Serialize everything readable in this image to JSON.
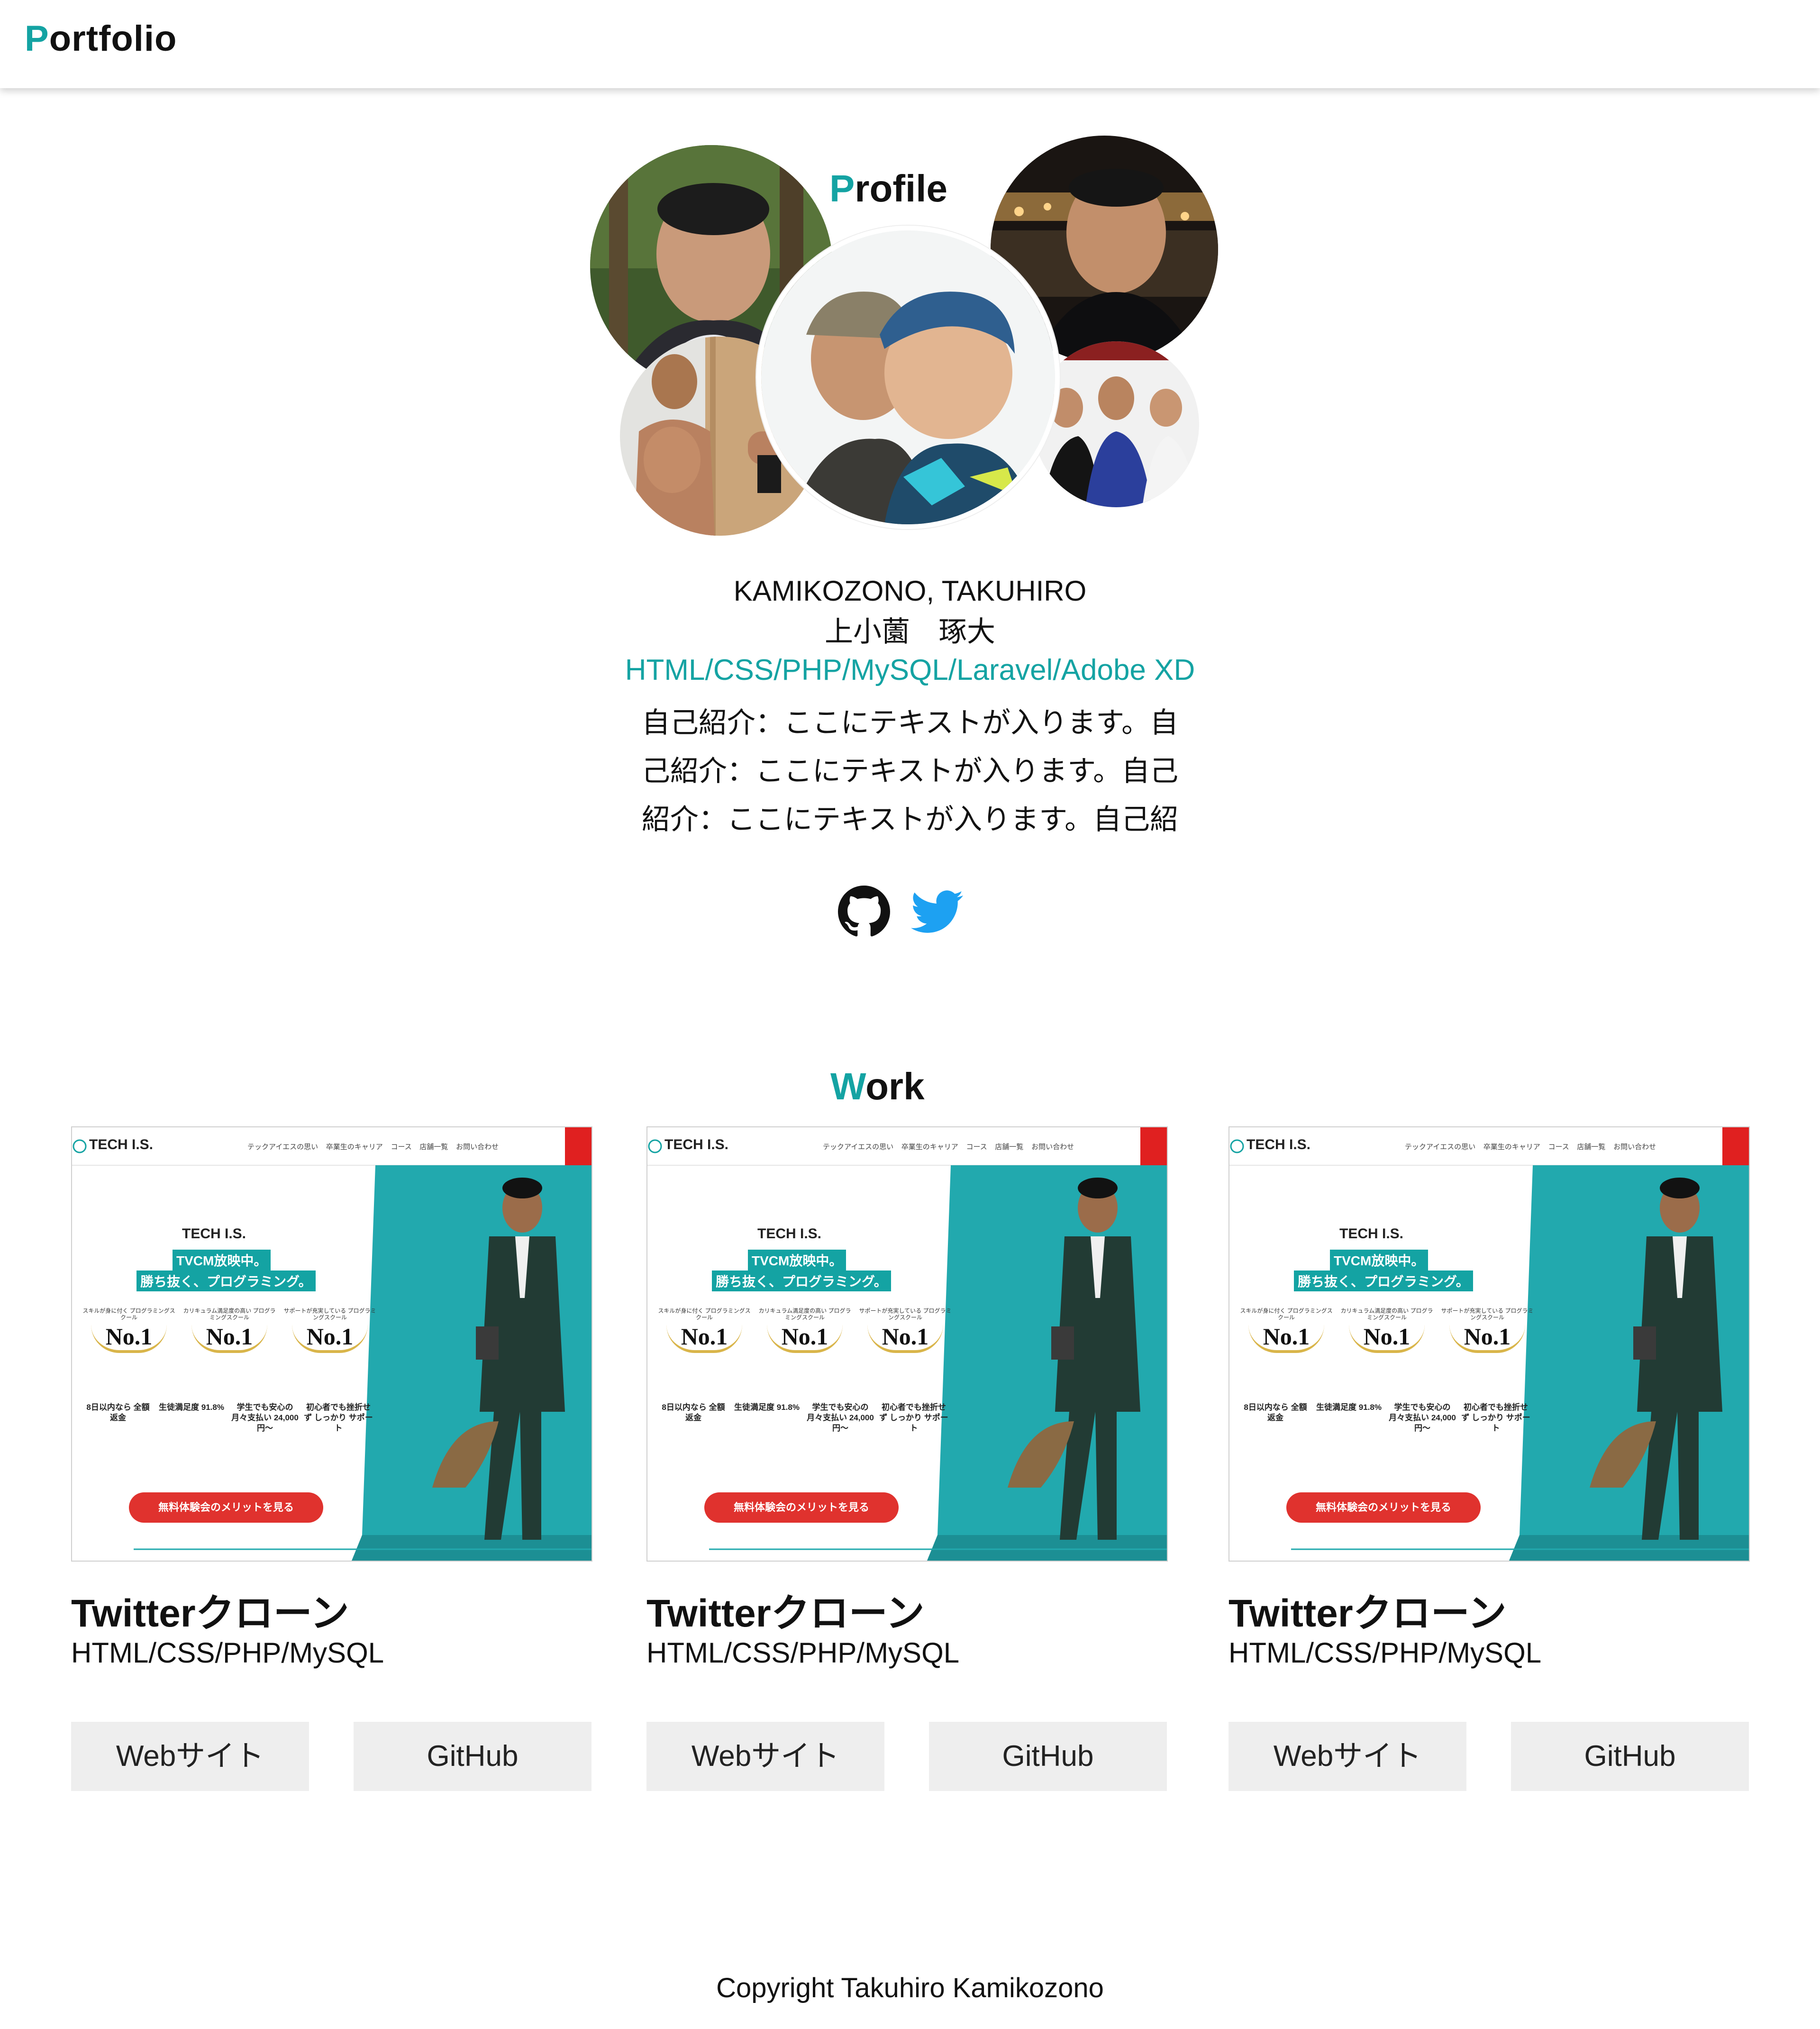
{
  "header": {
    "logo_initial": "P",
    "logo_rest": "ortfolio"
  },
  "profile": {
    "title_initial": "P",
    "title_rest": "rofile",
    "name_en": "KAMIKOZONO, TAKUHIRO",
    "name_ja": "上小薗　琢大",
    "skills": "HTML/CSS/PHP/MySQL/Laravel/Adobe XD",
    "bio_lines": [
      "自己紹介：ここにテキストが入ります。自",
      "己紹介：ここにテキストが入ります。自己",
      "紹介：ここにテキストが入ります。自己紹"
    ],
    "social": [
      "github-icon",
      "twitter-icon"
    ]
  },
  "work": {
    "title_initial": "W",
    "title_rest": "ork",
    "cards": [
      {
        "title": "Twitterクローン",
        "tech": "HTML/CSS/PHP/MySQL",
        "website_label": "Webサイト",
        "github_label": "GitHub",
        "thumb": {
          "brand": "TECH I.S.",
          "nav": [
            "テックアイエスの思い",
            "卒業生のキャリア",
            "コース",
            "店舗一覧",
            "お問い合わせ"
          ],
          "tagline1": "TVCM放映中。",
          "tagline2": "勝ち抜く、プログラミング。",
          "awards": [
            {
              "caption": "スキルが身に付く プログラミングスクール",
              "rank": "No.1"
            },
            {
              "caption": "カリキュラム満足度の高い プログラミングスクール",
              "rank": "No.1"
            },
            {
              "caption": "サポートが充実している プログラミングスクール",
              "rank": "No.1"
            }
          ],
          "stats": [
            "8日以内なら 全額返金",
            "生徒満足度 91.8%",
            "学生でも安心の 月々支払い 24,000円〜",
            "初心者でも挫折せず しっかり サポート"
          ],
          "cta": "無料体験会のメリットを見る"
        }
      },
      {
        "title": "Twitterクローン",
        "tech": "HTML/CSS/PHP/MySQL",
        "website_label": "Webサイト",
        "github_label": "GitHub",
        "thumb": {
          "brand": "TECH I.S.",
          "nav": [
            "テックアイエスの思い",
            "卒業生のキャリア",
            "コース",
            "店舗一覧",
            "お問い合わせ"
          ],
          "tagline1": "TVCM放映中。",
          "tagline2": "勝ち抜く、プログラミング。",
          "awards": [
            {
              "caption": "スキルが身に付く プログラミングスクール",
              "rank": "No.1"
            },
            {
              "caption": "カリキュラム満足度の高い プログラミングスクール",
              "rank": "No.1"
            },
            {
              "caption": "サポートが充実している プログラミングスクール",
              "rank": "No.1"
            }
          ],
          "stats": [
            "8日以内なら 全額返金",
            "生徒満足度 91.8%",
            "学生でも安心の 月々支払い 24,000円〜",
            "初心者でも挫折せず しっかり サポート"
          ],
          "cta": "無料体験会のメリットを見る"
        }
      },
      {
        "title": "Twitterクローン",
        "tech": "HTML/CSS/PHP/MySQL",
        "website_label": "Webサイト",
        "github_label": "GitHub",
        "thumb": {
          "brand": "TECH I.S.",
          "nav": [
            "テックアイエスの思い",
            "卒業生のキャリア",
            "コース",
            "店舗一覧",
            "お問い合わせ"
          ],
          "tagline1": "TVCM放映中。",
          "tagline2": "勝ち抜く、プログラミング。",
          "awards": [
            {
              "caption": "スキルが身に付く プログラミングスクール",
              "rank": "No.1"
            },
            {
              "caption": "カリキュラム満足度の高い プログラミングスクール",
              "rank": "No.1"
            },
            {
              "caption": "サポートが充実している プログラミングスクール",
              "rank": "No.1"
            }
          ],
          "stats": [
            "8日以内なら 全額返金",
            "生徒満足度 91.8%",
            "学生でも安心の 月々支払い 24,000円〜",
            "初心者でも挫折せず しっかり サポート"
          ],
          "cta": "無料体験会のメリットを見る"
        }
      }
    ]
  },
  "footer": {
    "copyright": "Copyright Takuhiro Kamikozono"
  },
  "colors": {
    "accent": "#14a3a3",
    "twitter": "#1da1f2",
    "button_bg": "#eeeeee",
    "cta_red": "#e0322e",
    "teal_bg": "#22a9ae"
  }
}
